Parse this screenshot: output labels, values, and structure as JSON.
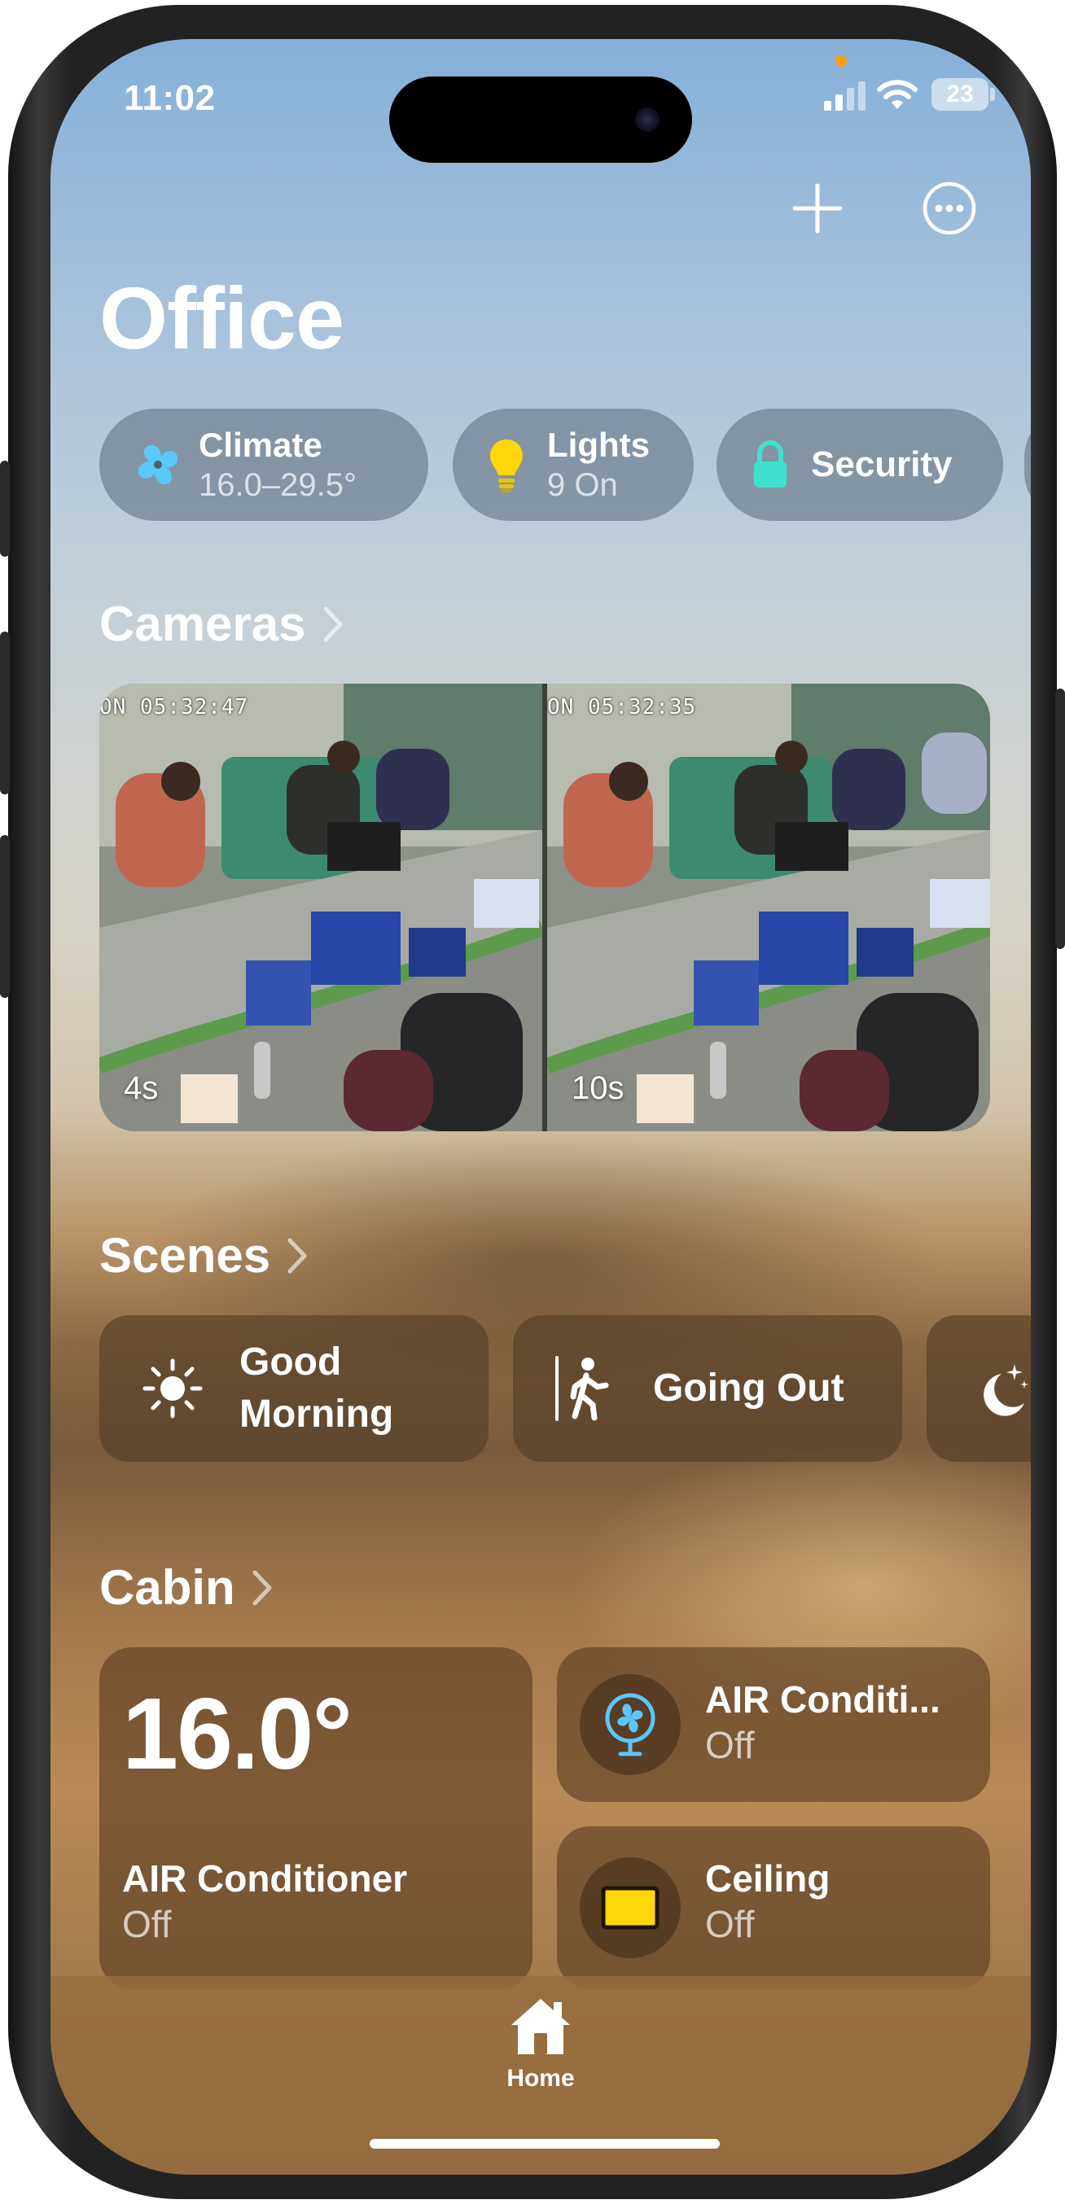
{
  "status_bar": {
    "time": "11:02",
    "battery": "23"
  },
  "header": {
    "title": "Office"
  },
  "categories": [
    {
      "title": "Climate",
      "subtitle": "16.0–29.5°",
      "icon": "fan-icon",
      "color": "#5ac8fa"
    },
    {
      "title": "Lights",
      "subtitle": "9 On",
      "icon": "lightbulb-icon",
      "color": "#ffd60a"
    },
    {
      "title": "Security",
      "icon": "lock-icon",
      "color": "#40e0d0"
    }
  ],
  "cameras": {
    "title": "Cameras",
    "feeds": [
      {
        "timestamp": "ON 05:32:47",
        "age": "4s"
      },
      {
        "timestamp": "ON 05:32:35",
        "age": "10s"
      }
    ]
  },
  "scenes": {
    "title": "Scenes",
    "items": [
      {
        "label_line1": "Good",
        "label_line2": "Morning",
        "icon": "sun-icon"
      },
      {
        "label": "Going Out",
        "icon": "walking-person-icon"
      },
      {
        "icon": "moon-stars-icon"
      }
    ]
  },
  "cabin": {
    "title": "Cabin",
    "thermostat": {
      "temperature": "16.0°",
      "name": "AIR Conditioner",
      "state": "Off"
    },
    "devices": [
      {
        "name": "AIR Conditi...",
        "state": "Off",
        "icon": "fan-icon"
      },
      {
        "name": "Ceiling",
        "state": "Off",
        "icon": "light-panel-icon"
      }
    ]
  },
  "tab_bar": {
    "home_label": "Home"
  },
  "colors": {
    "accent_fan": "#5ac8fa",
    "accent_light": "#ffd60a",
    "accent_lock": "#40e0d0"
  }
}
